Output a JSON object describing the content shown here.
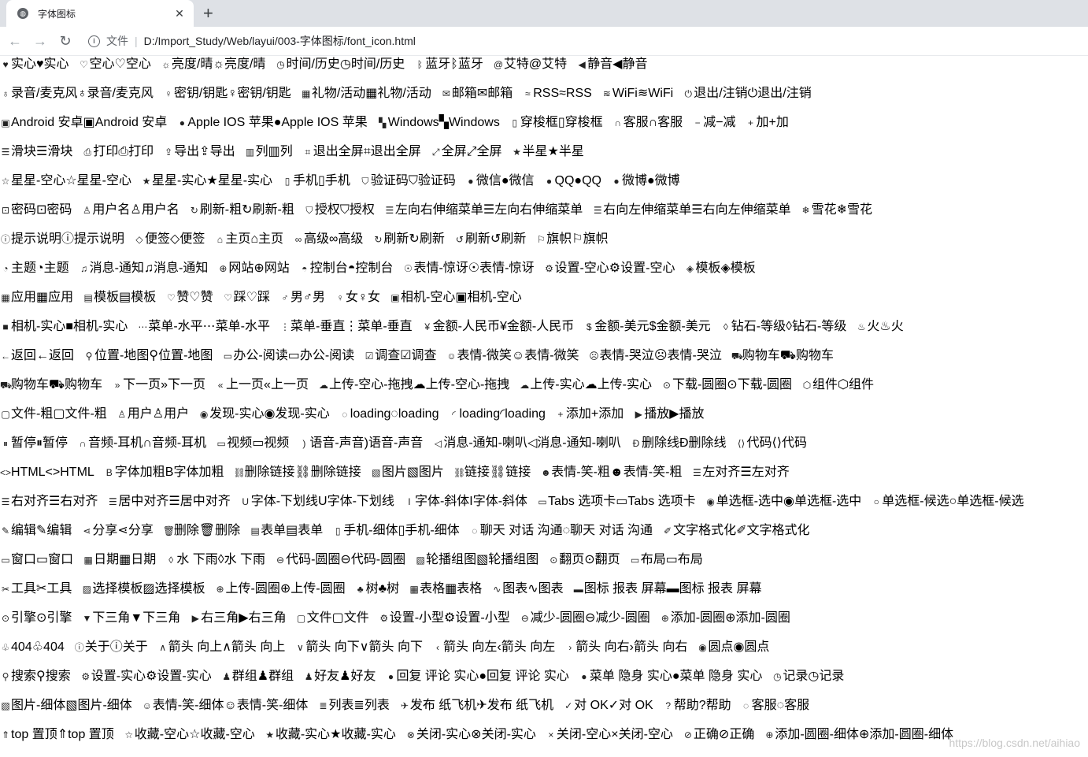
{
  "browser": {
    "tab_title": "字体图标",
    "close_glyph": "✕",
    "newtab_glyph": "+",
    "back_glyph": "←",
    "forward_glyph": "→",
    "reload_glyph": "↻",
    "info_glyph": "i",
    "file_label": "文件",
    "separator": "|",
    "url": "D:/Import_Study/Web/layui/003-字体图标/font_icon.html"
  },
  "rows": [
    [
      [
        "heart-fill-icon",
        "♥",
        "实心♥实心"
      ],
      [
        "heart-icon",
        "♡",
        "空心♡空心"
      ],
      [
        "sun-icon",
        "☼",
        "亮度/晴☼亮度/晴"
      ],
      [
        "clock-icon",
        "◷",
        "时间/历史◷时间/历史"
      ],
      [
        "bluetooth-icon",
        "ᛒ",
        "蓝牙ᛒ蓝牙"
      ],
      [
        "at-icon",
        "@",
        "艾特@艾特"
      ],
      [
        "mute-icon",
        "◀",
        "静音◀静音"
      ]
    ],
    [
      [
        "mic-icon",
        "♁",
        "录音/麦克风♁录音/麦克风"
      ],
      [
        "key-icon",
        "♀",
        "密钥/钥匙♀密钥/钥匙"
      ],
      [
        "gift-icon",
        "▦",
        "礼物/活动▦礼物/活动"
      ],
      [
        "mail-icon",
        "✉",
        "邮箱✉邮箱"
      ],
      [
        "rss-icon",
        "≈",
        "RSS≈RSS"
      ],
      [
        "wifi-icon",
        "≋",
        "WiFi≋WiFi"
      ],
      [
        "logout-icon",
        "⏻",
        "退出/注销⏻退出/注销"
      ]
    ],
    [
      [
        "android-icon",
        "▣",
        "Android 安卓▣Android 安卓"
      ],
      [
        "apple-icon",
        "●",
        "Apple IOS 苹果●Apple IOS 苹果"
      ],
      [
        "windows-icon",
        "▚",
        "Windows▚Windows"
      ],
      [
        "shuttle-icon",
        "▯",
        "穿梭框▯穿梭框"
      ],
      [
        "headset-icon",
        "∩",
        "客服∩客服"
      ],
      [
        "minus-icon",
        "−",
        "减−减"
      ],
      [
        "plus-icon",
        "+",
        "加+加"
      ]
    ],
    [
      [
        "slider-icon",
        "☰",
        "滑块☰滑块"
      ],
      [
        "print-icon",
        "⎙",
        "打印⎙打印"
      ],
      [
        "export-icon",
        "⇪",
        "导出⇪导出"
      ],
      [
        "column-icon",
        "▥",
        "列▥列"
      ],
      [
        "exit-fullscreen-icon",
        "⌗",
        "退出全屏⌗退出全屏"
      ],
      [
        "fullscreen-icon",
        "⤢",
        "全屏⤢全屏"
      ],
      [
        "half-star-icon",
        "★",
        "半星★半星"
      ]
    ],
    [
      [
        "star-icon",
        "☆",
        "星星-空心☆星星-空心"
      ],
      [
        "star-fill-icon",
        "★",
        "星星-实心★星星-实心"
      ],
      [
        "cellphone-icon",
        "▯",
        "手机▯手机"
      ],
      [
        "vercode-icon",
        "⛉",
        "验证码⛉验证码"
      ],
      [
        "wechat-icon",
        "●",
        "微信●微信"
      ],
      [
        "qq-icon",
        "●",
        "QQ●QQ"
      ],
      [
        "weibo-icon",
        "●",
        "微博●微博"
      ]
    ],
    [
      [
        "password-icon",
        "⊡",
        "密码⊡密码"
      ],
      [
        "user-icon",
        "♙",
        "用户名♙用户名"
      ],
      [
        "refresh-bold-icon",
        "↻",
        "刷新-粗↻刷新-粗"
      ],
      [
        "auz-icon",
        "⛉",
        "授权⛉授权"
      ],
      [
        "spread-left-icon",
        "☰",
        "左向右伸缩菜单☰左向右伸缩菜单"
      ],
      [
        "shrink-right-icon",
        "☰",
        "右向左伸缩菜单☰右向左伸缩菜单"
      ],
      [
        "snowflake-icon",
        "❄",
        "雪花❄雪花"
      ]
    ],
    [
      [
        "tips-icon",
        "ⓘ",
        "提示说明ⓘ提示说明"
      ],
      [
        "note-icon",
        "◇",
        "便签◇便签"
      ],
      [
        "home-icon",
        "⌂",
        "主页⌂主页"
      ],
      [
        "senior-icon",
        "∞",
        "高级∞高级"
      ],
      [
        "refresh-icon",
        "↻",
        "刷新↻刷新"
      ],
      [
        "refresh-alt-icon",
        "↺",
        "刷新↺刷新"
      ],
      [
        "flag-icon",
        "⚐",
        "旗帜⚐旗帜"
      ]
    ],
    [
      [
        "theme-icon",
        "◔",
        "主题◔主题"
      ],
      [
        "notice-icon",
        "♫",
        "消息-通知♫消息-通知"
      ],
      [
        "website-icon",
        "⊕",
        "网站⊕网站"
      ],
      [
        "console-icon",
        "◓",
        "控制台◓控制台"
      ],
      [
        "surprised-icon",
        "☉",
        "表情-惊讶☉表情-惊讶"
      ],
      [
        "set-icon",
        "⚙",
        "设置-空心⚙设置-空心"
      ],
      [
        "template-fill-icon",
        "◈",
        "模板◈模板"
      ]
    ],
    [
      [
        "app-icon",
        "▦",
        "应用▦应用"
      ],
      [
        "template-icon",
        "▤",
        "模板▤模板"
      ],
      [
        "praise-icon",
        "♡",
        "赞♡赞"
      ],
      [
        "tread-icon",
        "♡",
        "踩♡踩"
      ],
      [
        "male-icon",
        "♂",
        "男♂男"
      ],
      [
        "female-icon",
        "♀",
        "女♀女"
      ],
      [
        "camera-icon",
        "▣",
        "相机-空心▣相机-空心"
      ]
    ],
    [
      [
        "camera-fill-icon",
        "■",
        "相机-实心■相机-实心"
      ],
      [
        "more-icon",
        "⋯",
        "菜单-水平⋯菜单-水平"
      ],
      [
        "more-vertical-icon",
        "⋮",
        "菜单-垂直⋮菜单-垂直"
      ],
      [
        "rmb-icon",
        "¥",
        "金额-人民币¥金额-人民币"
      ],
      [
        "dollar-icon",
        "$",
        "金额-美元$金额-美元"
      ],
      [
        "diamond-icon",
        "◊",
        "钻石-等级◊钻石-等级"
      ],
      [
        "fire-icon",
        "♨",
        "火♨火"
      ]
    ],
    [
      [
        "return-icon",
        "←",
        "返回←返回"
      ],
      [
        "location-icon",
        "⚲",
        "位置-地图⚲位置-地图"
      ],
      [
        "read-icon",
        "▭",
        "办公-阅读▭办公-阅读"
      ],
      [
        "survey-icon",
        "☑",
        "调查☑调查"
      ],
      [
        "face-smile-icon",
        "☺",
        "表情-微笑☺表情-微笑"
      ],
      [
        "face-cry-icon",
        "☹",
        "表情-哭泣☹表情-哭泣"
      ],
      [
        "cart-simple-icon",
        "⛟",
        "购物车⛟购物车"
      ]
    ],
    [
      [
        "cart-icon",
        "⛟",
        "购物车⛟购物车"
      ],
      [
        "next-icon",
        "»",
        "下一页»下一页"
      ],
      [
        "prev-icon",
        "«",
        "上一页«上一页"
      ],
      [
        "upload-drag-icon",
        "☁",
        "上传-空心-拖拽☁上传-空心-拖拽"
      ],
      [
        "upload-icon",
        "☁",
        "上传-实心☁上传-实心"
      ],
      [
        "download-circle-icon",
        "⊙",
        "下载-圆圈⊙下载-圆圈"
      ],
      [
        "component-icon",
        "⬡",
        "组件⬡组件"
      ]
    ],
    [
      [
        "file-b-icon",
        "▢",
        "文件-粗▢文件-粗"
      ],
      [
        "user-alt-icon",
        "♙",
        "用户♙用户"
      ],
      [
        "find-fill-icon",
        "◉",
        "发现-实心◉发现-实心"
      ],
      [
        "loading-icon",
        "◌",
        "loading◌loading"
      ],
      [
        "loading-1-icon",
        "◜",
        "loading◜loading"
      ],
      [
        "add-1-icon",
        "+",
        "添加+添加"
      ],
      [
        "play-icon",
        "▶",
        "播放▶播放"
      ]
    ],
    [
      [
        "pause-icon",
        "⏸",
        "暂停⏸暂停"
      ],
      [
        "headset-alt-icon",
        "∩",
        "音频-耳机∩音频-耳机"
      ],
      [
        "video-icon",
        "▭",
        "视频▭视频"
      ],
      [
        "voice-icon",
        ")",
        "语音-声音)语音-声音"
      ],
      [
        "speaker-icon",
        "◁",
        "消息-通知-喇叭◁消息-通知-喇叭"
      ],
      [
        "fonts-del-icon",
        "Ð",
        "删除线Ð删除线"
      ],
      [
        "fonts-code-icon",
        "⟨⟩",
        "代码⟨⟩代码"
      ]
    ],
    [
      [
        "fonts-html-icon",
        "<>",
        "HTML<>HTML"
      ],
      [
        "fonts-strong-icon",
        "B",
        "字体加粗B字体加粗"
      ],
      [
        "unlink-icon",
        "⛓",
        "删除链接⛓删除链接"
      ],
      [
        "picture-icon",
        "▧",
        "图片▧图片"
      ],
      [
        "link-icon",
        "⛓",
        "链接⛓链接"
      ],
      [
        "face-smile-b-icon",
        "☻",
        "表情-笑-粗☻表情-笑-粗"
      ],
      [
        "align-left-icon",
        "☰",
        "左对齐☰左对齐"
      ]
    ],
    [
      [
        "align-right-icon",
        "☰",
        "右对齐☰右对齐"
      ],
      [
        "align-center-icon",
        "☰",
        "居中对齐☰居中对齐"
      ],
      [
        "fonts-u-icon",
        "U",
        "字体-下划线U字体-下划线"
      ],
      [
        "fonts-i-icon",
        "I",
        "字体-斜体I字体-斜体"
      ],
      [
        "tabs-icon",
        "▭",
        "Tabs 选项卡▭Tabs 选项卡"
      ],
      [
        "radio-icon",
        "◉",
        "单选框-选中◉单选框-选中"
      ],
      [
        "circle-icon",
        "○",
        "单选框-候选○单选框-候选"
      ]
    ],
    [
      [
        "edit-icon",
        "✎",
        "编辑✎编辑"
      ],
      [
        "share-icon",
        "⋖",
        "分享⋖分享"
      ],
      [
        "delete-icon",
        "🗑",
        "删除🗑删除"
      ],
      [
        "form-icon",
        "▤",
        "表单▤表单"
      ],
      [
        "cellphone-fine-icon",
        "▯",
        "手机-细体▯手机-细体"
      ],
      [
        "dialogue-icon",
        "◌",
        "聊天 对话 沟通◌聊天 对话 沟通"
      ],
      [
        "fonts-clear-icon",
        "✐",
        "文字格式化✐文字格式化"
      ]
    ],
    [
      [
        "layer-icon",
        "▭",
        "窗口▭窗口"
      ],
      [
        "date-icon",
        "▦",
        "日期▦日期"
      ],
      [
        "water-icon",
        "◊",
        "水 下雨◊水 下雨"
      ],
      [
        "code-circle-icon",
        "⊖",
        "代码-圆圈⊖代码-圆圈"
      ],
      [
        "carousel-icon",
        "▧",
        "轮播组图▧轮播组图"
      ],
      [
        "prev-circle-icon",
        "⊙",
        "翻页⊙翻页"
      ],
      [
        "layouts-icon",
        "▭",
        "布局▭布局"
      ]
    ],
    [
      [
        "util-icon",
        "✂",
        "工具✂工具"
      ],
      [
        "templeate-1-icon",
        "▨",
        "选择模板▨选择模板"
      ],
      [
        "upload-circle-icon",
        "⊕",
        "上传-圆圈⊕上传-圆圈"
      ],
      [
        "tree-icon",
        "♣",
        "树♣树"
      ],
      [
        "table-icon",
        "▦",
        "表格▦表格"
      ],
      [
        "chart-icon",
        "∿",
        "图表∿图表"
      ],
      [
        "chart-screen-icon",
        "▬",
        "图标 报表 屏幕▬图标 报表 屏幕"
      ]
    ],
    [
      [
        "engine-icon",
        "⊙",
        "引擎⊙引擎"
      ],
      [
        "triangle-d-icon",
        "▼",
        "下三角▼下三角"
      ],
      [
        "triangle-r-icon",
        "▶",
        "右三角▶右三角"
      ],
      [
        "file-icon",
        "▢",
        "文件▢文件"
      ],
      [
        "set-sm-icon",
        "⚙",
        "设置-小型⚙设置-小型"
      ],
      [
        "reduce-circle-icon",
        "⊖",
        "减少-圆圈⊖减少-圆圈"
      ],
      [
        "add-circle-icon",
        "⊕",
        "添加-圆圈⊕添加-圆圈"
      ]
    ],
    [
      [
        "404-icon",
        "♧",
        "404♧404"
      ],
      [
        "about-icon",
        "ⓘ",
        "关于ⓘ关于"
      ],
      [
        "up-icon",
        "∧",
        "箭头 向上∧箭头 向上"
      ],
      [
        "down-icon",
        "∨",
        "箭头 向下∨箭头 向下"
      ],
      [
        "left-icon",
        "‹",
        "箭头 向左‹箭头 向左"
      ],
      [
        "right-icon",
        "›",
        "箭头 向右›箭头 向右"
      ],
      [
        "circle-dot-icon",
        "◉",
        "圆点◉圆点"
      ]
    ],
    [
      [
        "search-icon",
        "⚲",
        "搜索⚲搜索"
      ],
      [
        "set-fill-icon",
        "⚙",
        "设置-实心⚙设置-实心"
      ],
      [
        "group-icon",
        "♟",
        "群组♟群组"
      ],
      [
        "friends-icon",
        "♟",
        "好友♟好友"
      ],
      [
        "reply-fill-icon",
        "●",
        "回复 评论 实心●回复 评论 实心"
      ],
      [
        "menu-fill-icon",
        "●",
        "菜单 隐身 实心●菜单 隐身 实心"
      ],
      [
        "log-icon",
        "◷",
        "记录◷记录"
      ]
    ],
    [
      [
        "picture-fine-icon",
        "▧",
        "图片-细体▧图片-细体"
      ],
      [
        "face-smile-fine-icon",
        "☺",
        "表情-笑-细体☺表情-笑-细体"
      ],
      [
        "list-icon",
        "≣",
        "列表≣列表"
      ],
      [
        "release-icon",
        "✈",
        "发布 纸飞机✈发布 纸飞机"
      ],
      [
        "ok-icon",
        "✓",
        "对 OK✓对 OK"
      ],
      [
        "help-icon",
        "?",
        "帮助?帮助"
      ],
      [
        "chat-icon",
        "◌",
        "客服◌客服"
      ]
    ],
    [
      [
        "top-icon",
        "⇑",
        "top 置顶⇑top 置顶"
      ],
      [
        "star-outline-icon",
        "☆",
        "收藏-空心☆收藏-空心"
      ],
      [
        "star-solid-icon",
        "★",
        "收藏-实心★收藏-实心"
      ],
      [
        "close-fill-icon",
        "⊗",
        "关闭-实心⊗关闭-实心"
      ],
      [
        "close-icon",
        "×",
        "关闭-空心×关闭-空心"
      ],
      [
        "ok-circle-icon",
        "⊘",
        "正确⊘正确"
      ],
      [
        "add-circle-fine-icon",
        "⊕",
        "添加-圆圈-细体⊕添加-圆圈-细体"
      ]
    ]
  ],
  "watermark": "https://blog.csdn.net/aihiao"
}
